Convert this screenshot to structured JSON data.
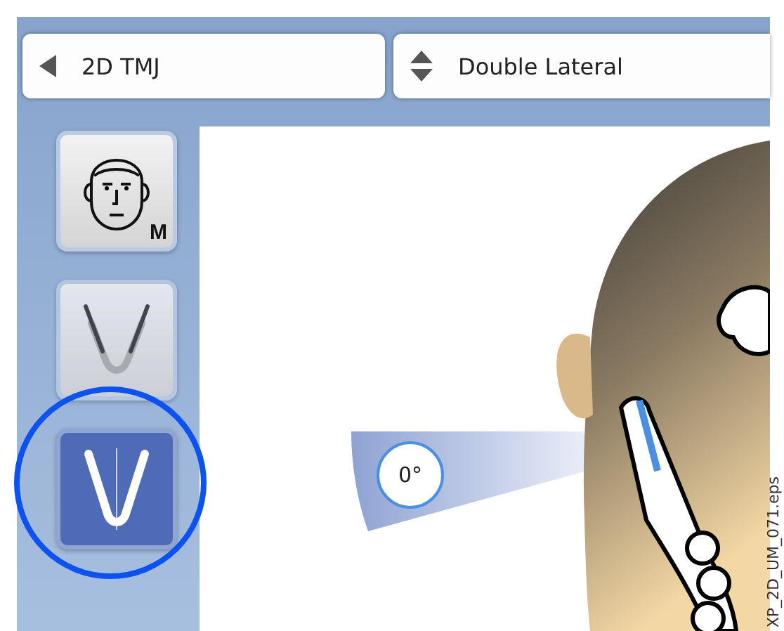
{
  "header": {
    "program": {
      "label": "2D TMJ"
    },
    "view": {
      "label": "Double Lateral"
    }
  },
  "sidebar": {
    "buttons": [
      {
        "kind": "face",
        "badge": "M",
        "selected": false,
        "disabled": false
      },
      {
        "kind": "jaw-open",
        "selected": false,
        "disabled": true
      },
      {
        "kind": "jaw-centered",
        "selected": true,
        "disabled": false
      }
    ]
  },
  "preview": {
    "angle": "0°"
  },
  "figure_label": "XP_2D_UM_071.eps"
}
